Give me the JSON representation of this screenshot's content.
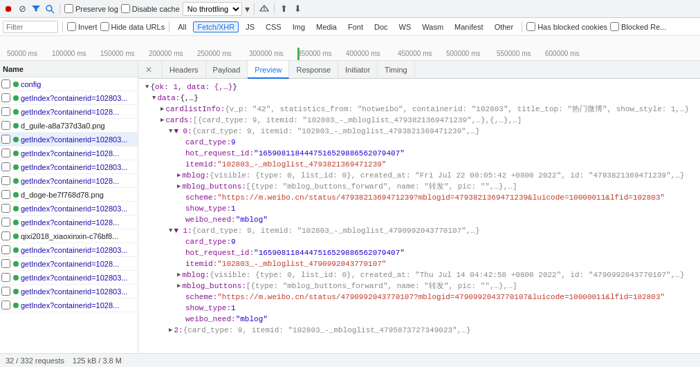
{
  "toolbar": {
    "icons": [
      {
        "name": "record-icon",
        "symbol": "⏺",
        "class": "red",
        "title": "Record network log"
      },
      {
        "name": "clear-icon",
        "symbol": "🚫",
        "title": "Clear"
      },
      {
        "name": "filter-icon",
        "symbol": "⚗",
        "class": "active",
        "title": "Filter"
      },
      {
        "name": "search-icon",
        "symbol": "🔍",
        "title": "Search"
      }
    ],
    "preserve_log_label": "Preserve log",
    "disable_cache_label": "Disable cache",
    "no_throttling_label": "No throttling",
    "upload_icon": "⬆",
    "download_icon": "⬇",
    "online_icon": "📶"
  },
  "filter_bar": {
    "filter_placeholder": "Filter",
    "invert_label": "Invert",
    "hide_data_urls_label": "Hide data URLs",
    "buttons": [
      "All",
      "Fetch/XHR",
      "JS",
      "CSS",
      "Img",
      "Media",
      "Font",
      "Doc",
      "WS",
      "Wasm",
      "Manifest",
      "Other"
    ],
    "active_button": "Fetch/XHR",
    "has_blocked_cookies_label": "Has blocked cookies",
    "blocked_requests_label": "Blocked Re..."
  },
  "timeline": {
    "ticks": [
      "50000 ms",
      "100000 ms",
      "150000 ms",
      "200000 ms",
      "250000 ms",
      "300000 ms",
      "350000 ms",
      "400000 ms",
      "450000 ms",
      "500000 ms",
      "550000 ms",
      "600000 ms"
    ]
  },
  "network_list": {
    "header": "Name",
    "items": [
      {
        "name": "config",
        "status": "green",
        "type": "xhr"
      },
      {
        "name": "getIndex?containerid=102803...",
        "status": "green",
        "type": "xhr"
      },
      {
        "name": "getIndex?containerid=1028...",
        "status": "green",
        "type": "xhr"
      },
      {
        "name": "d_guile-a8a737d3a0.png",
        "status": "green",
        "type": "image"
      },
      {
        "name": "getIndex?containerid=102803...",
        "status": "green",
        "type": "xhr",
        "selected": true
      },
      {
        "name": "getIndex?containerid=1028...",
        "status": "green",
        "type": "xhr"
      },
      {
        "name": "getIndex?containerid=102803...",
        "status": "green",
        "type": "xhr"
      },
      {
        "name": "getIndex?containerid=1028...",
        "status": "green",
        "type": "xhr"
      },
      {
        "name": "d_doge-be7f768d78.png",
        "status": "green",
        "type": "image"
      },
      {
        "name": "getIndex?containerid=102803...",
        "status": "green",
        "type": "xhr"
      },
      {
        "name": "getIndex?containerid=1028...",
        "status": "green",
        "type": "xhr"
      },
      {
        "name": "qixi2018_xiaoxinxin-c76bf8...",
        "status": "green",
        "type": "image"
      },
      {
        "name": "getIndex?containerid=102803...",
        "status": "green",
        "type": "xhr"
      },
      {
        "name": "getIndex?containerid=1028...",
        "status": "green",
        "type": "xhr"
      },
      {
        "name": "getIndex?containerid=102803...",
        "status": "green",
        "type": "xhr"
      },
      {
        "name": "getIndex?containerid=102803...",
        "status": "green",
        "type": "xhr"
      },
      {
        "name": "getIndex?containerid=1028...",
        "status": "green",
        "type": "xhr"
      }
    ]
  },
  "detail": {
    "tabs": [
      {
        "label": "×",
        "type": "close"
      },
      {
        "label": "Headers"
      },
      {
        "label": "Payload"
      },
      {
        "label": "Preview",
        "active": true
      },
      {
        "label": "Response"
      },
      {
        "label": "Initiator"
      },
      {
        "label": "Timing"
      }
    ]
  },
  "preview": {
    "root_ok": "{ok: 1, data: {,…}}",
    "data_label": "data: {,…}",
    "cardlist_info": "cardlistInfo: {v_p: \"42\", statistics_from: \"hotweibo\", containerid: \"102803\", title_top: \"热门微博\", show_style: 1,…}",
    "cards_label": "cards: [{card_type: 9, itemid: \"102803_-_mbloglist_4793821369471239\",…},{,…},…]",
    "card0_label": "0: {card_type: 9, itemid: \"102803_-_mbloglist_4793821369471239\",…}",
    "card0_type": "card_type: 9",
    "card0_hot_request_id": "hot_request_id: \"1659081184447516529886562079407\"",
    "card0_itemid": "itemid: \"102803_-_mbloglist_4793821369471239\"",
    "card0_mblog": "mblog: {visible: {type: 0, list_id: 0}, created_at: \"Fri Jul 22 00:05:42 +0800 2022\", id: \"4793821369471239\",…}",
    "card0_mblog_buttons": "mblog_buttons: [{type: \"mblog_buttons_forward\", name: \"转发\", pic: \"\",…},…]",
    "card0_scheme": "scheme: \"https://m.weibo.cn/status/4793821369471239?mblogid=4793821369471239&luicode=10000011&lfid=102803\"",
    "card0_show_type": "show_type: 1",
    "card0_weibo_need": "weibo_need: \"mblog\"",
    "card1_label": "1: {card_type: 9, itemid: \"102803_-_mbloglist_4790992043770107\",…}",
    "card1_type": "card_type: 9",
    "card1_hot_request_id": "hot_request_id: \"1659081184447516529886562079407\"",
    "card1_itemid": "itemid: \"102803_-_mbloglist_4790992043770107\"",
    "card1_mblog": "mblog: {visible: {type: 0, list_id: 0}, created_at: \"Thu Jul 14 04:42:58 +0800 2022\", id: \"4790992043770107\",…}",
    "card1_mblog_buttons": "mblog_buttons: [{type: \"mblog_buttons_forward\", name: \"转发\", pic: \"\",…},…]",
    "card1_scheme": "scheme: \"https://m.weibo.cn/status/4790992043770107?mblogid=4790992043770107&luicode=10000011&lfid=102803\"",
    "card1_show_type": "show_type: 1",
    "card1_weibo_need": "weibo_need: \"mblog\"",
    "card2_label": "2: {card_type: 9, itemid: \"102803_-_mbloglist_4795873727349023\",…}"
  },
  "status_bar": {
    "requests": "32 / 332 requests",
    "size": "125 kB / 3.8 M"
  },
  "colors": {
    "accent": "#1a73e8",
    "url_color": "#c0392b",
    "key_color": "#881391",
    "string_color": "#1c00cf"
  }
}
